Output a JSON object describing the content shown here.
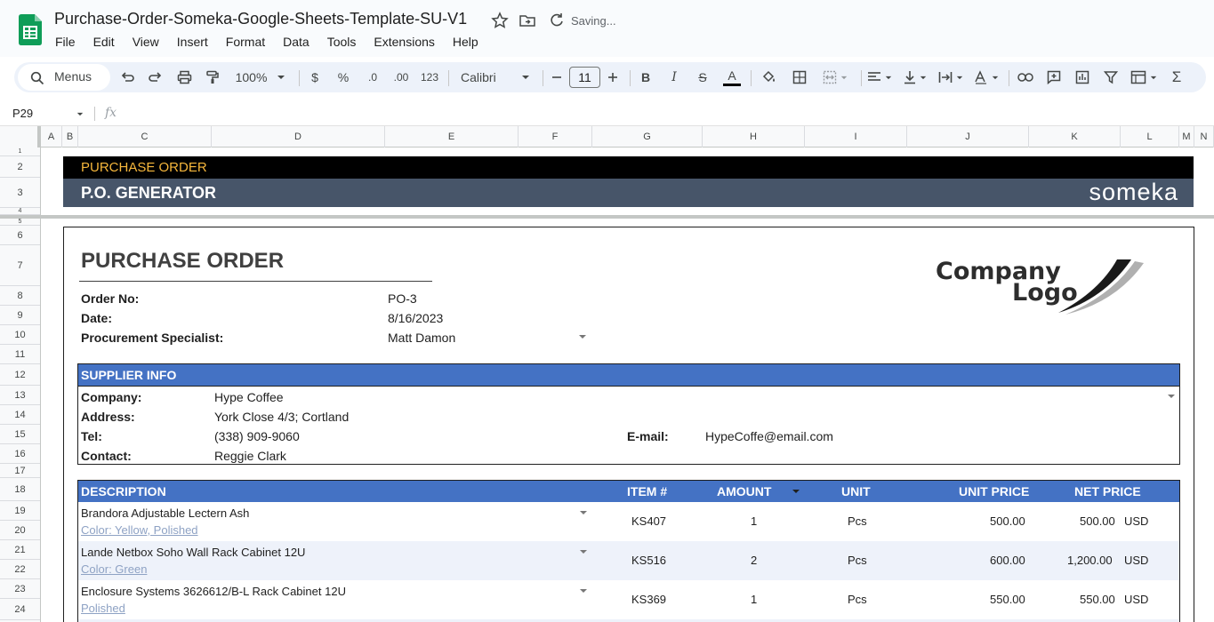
{
  "app": {
    "title": "Purchase-Order-Someka-Google-Sheets-Template-SU-V1",
    "status": "Saving..."
  },
  "menu": [
    "File",
    "Edit",
    "View",
    "Insert",
    "Format",
    "Data",
    "Tools",
    "Extensions",
    "Help"
  ],
  "toolbar": {
    "search_label": "Menus",
    "zoom": "100%",
    "currency": "$",
    "percent": "%",
    "decimal_decrease": ".0",
    "decimal_increase": ".00",
    "number_format": "123",
    "font": "Calibri",
    "font_size": "11",
    "bold": "B",
    "italic": "I",
    "strikethrough": "S",
    "text_color": "A",
    "sum": "Σ"
  },
  "formula_bar": {
    "cell_ref": "P29",
    "fx": "fx"
  },
  "columns": [
    "A",
    "B",
    "C",
    "D",
    "E",
    "F",
    "G",
    "H",
    "I",
    "J",
    "K",
    "L",
    "M",
    "N"
  ],
  "rows": [
    "1",
    "2",
    "3",
    "4",
    "5",
    "6",
    "7",
    "8",
    "9",
    "10",
    "11",
    "12",
    "13",
    "14",
    "15",
    "16",
    "17",
    "18",
    "19",
    "20",
    "21",
    "22",
    "23",
    "24"
  ],
  "banner": {
    "top": "PURCHASE ORDER",
    "bottom": "P.O. GENERATOR",
    "brand": "someka",
    "top_color": "#f6b73c",
    "bottom_bg": "#475569"
  },
  "doc": {
    "title": "PURCHASE ORDER",
    "order_no_label": "Order No:",
    "order_no": "PO-3",
    "date_label": "Date:",
    "date": "8/16/2023",
    "specialist_label": "Procurement Specialist:",
    "specialist": "Matt Damon",
    "logo_line1": "Company",
    "logo_line2": "Logo"
  },
  "supplier": {
    "header": "SUPPLIER INFO",
    "company_label": "Company:",
    "company": "Hype Coffee",
    "address_label": "Address:",
    "address": "York Close 4/3; Cortland",
    "tel_label": "Tel:",
    "tel": "(338) 909-9060",
    "email_label": "E-mail:",
    "email": "HypeCoffe@email.com",
    "contact_label": "Contact:",
    "contact": "Reggie Clark"
  },
  "items": {
    "headers": {
      "description": "DESCRIPTION",
      "item": "ITEM #",
      "amount": "AMOUNT",
      "unit": "UNIT",
      "unit_price": "UNIT PRICE",
      "net_price": "NET PRICE"
    },
    "rows": [
      {
        "name": "Brandora Adjustable Lectern Ash",
        "note": "Color: Yellow, Polished",
        "item": "KS407",
        "amount": "1",
        "unit": "Pcs",
        "unit_price": "500.00",
        "net_price": "500.00",
        "currency": "USD"
      },
      {
        "name": "Lande Netbox Soho Wall Rack Cabinet 12U",
        "note": "Color: Green",
        "item": "KS516",
        "amount": "2",
        "unit": "Pcs",
        "unit_price": "600.00",
        "net_price": "1,200.00",
        "currency": "USD"
      },
      {
        "name": "Enclosure Systems 3626612/B-L Rack Cabinet 12U",
        "note": "Polished",
        "item": "KS369",
        "amount": "1",
        "unit": "Pcs",
        "unit_price": "550.00",
        "net_price": "550.00",
        "currency": "USD"
      }
    ],
    "header_bg": "#4472c4"
  }
}
